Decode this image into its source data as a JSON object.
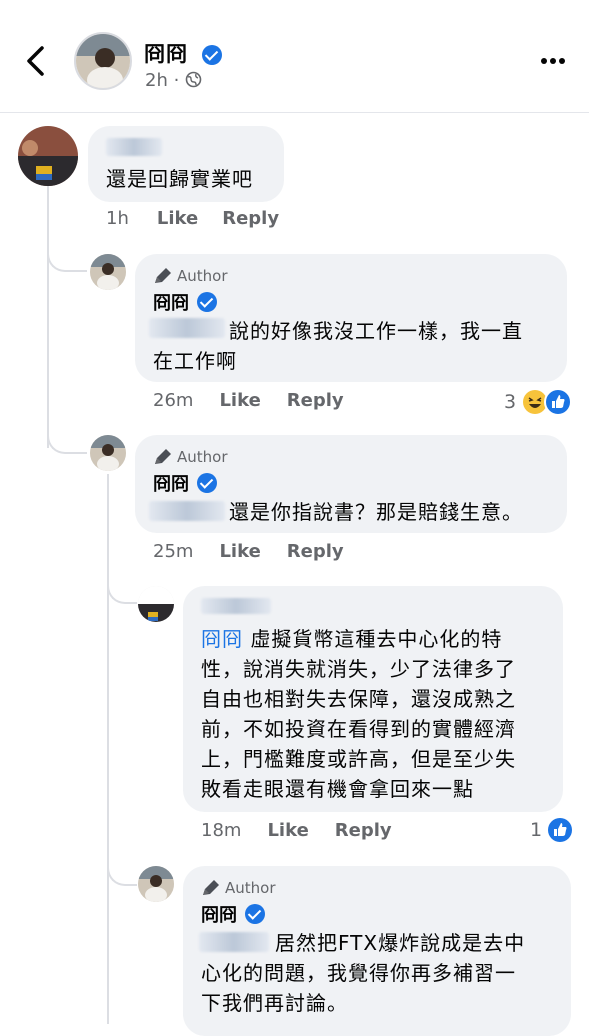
{
  "header": {
    "name": "冏冏",
    "time": "2h",
    "time_sep": "·"
  },
  "comments": [
    {
      "text": "還是回歸實業吧",
      "time": "1h",
      "like": "Like",
      "reply": "Reply"
    },
    {
      "author_tag": "Author",
      "name": "冏冏",
      "text_line1": "說的好像我沒工作一樣，我一直",
      "text_line2": "在工作啊",
      "time": "26m",
      "like": "Like",
      "reply": "Reply",
      "reaction_count": "3"
    },
    {
      "author_tag": "Author",
      "name": "冏冏",
      "text": "還是你指說書？那是賠錢生意。",
      "time": "25m",
      "like": "Like",
      "reply": "Reply"
    },
    {
      "mention": "冏冏",
      "text_line1": "虛擬貨幣這種去中心化的特",
      "text_line2": "性，說消失就消失，少了法律多了",
      "text_line3": "自由也相對失去保障，還沒成熟之",
      "text_line4": "前，不如投資在看得到的實體經濟",
      "text_line5": "上，門檻難度或許高，但是至少失",
      "text_line6": "敗看走眼還有機會拿回來一點",
      "time": "18m",
      "like": "Like",
      "reply": "Reply",
      "reaction_count": "1"
    },
    {
      "author_tag": "Author",
      "name": "冏冏",
      "text_line1": "居然把FTX爆炸說成是去中",
      "text_line2": "心化的問題，我覺得你再多補習一",
      "text_line3": "下我們再討論。"
    }
  ],
  "colors": {
    "bubble": "#f0f2f5",
    "accent": "#1b74e4",
    "muted": "#65676b"
  }
}
